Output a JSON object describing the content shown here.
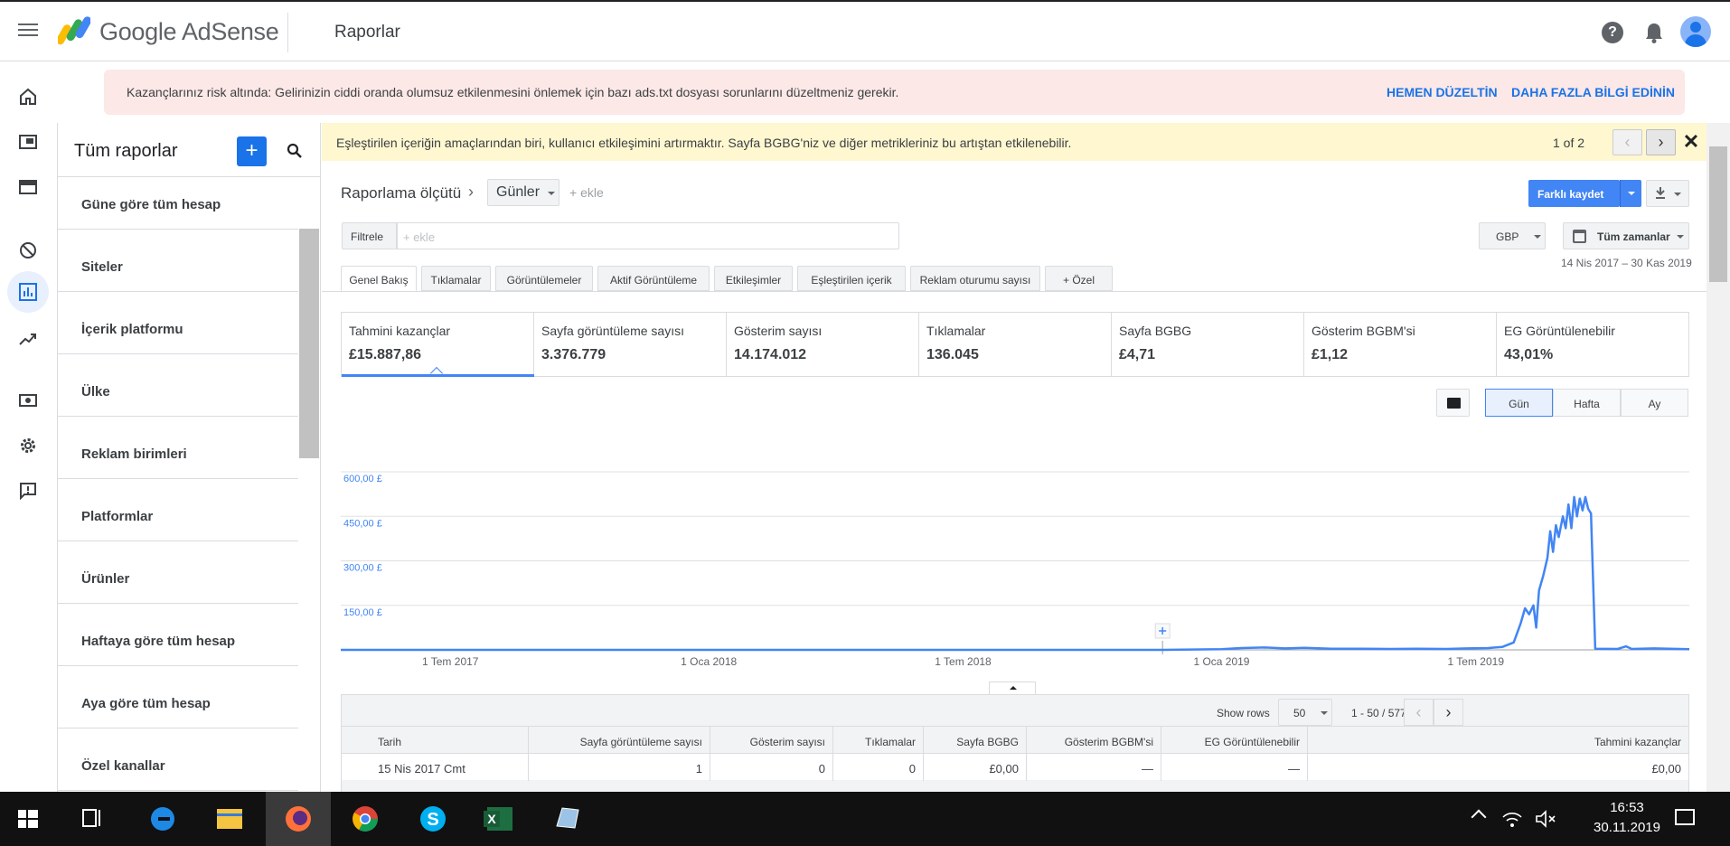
{
  "app": {
    "brand": "Google AdSense",
    "page_title": "Raporlar"
  },
  "risk_banner": {
    "text": "Kazançlarınız risk altında: Gelirinizin ciddi oranda olumsuz etkilenmesini önlemek için bazı ads.txt dosyası sorunlarını düzeltmeniz gerekir.",
    "fix_link": "HEMEN DÜZELTİN",
    "more_link": "DAHA FAZLA BİLGİ EDİNİN"
  },
  "sidebar": {
    "title": "Tüm raporlar",
    "add_label": "+",
    "items": [
      {
        "label": "Güne göre tüm hesap"
      },
      {
        "label": "Siteler"
      },
      {
        "label": "İçerik platformu"
      },
      {
        "label": "Ülke"
      },
      {
        "label": "Reklam birimleri"
      },
      {
        "label": "Platformlar"
      },
      {
        "label": "Ürünler"
      },
      {
        "label": "Haftaya göre tüm hesap"
      },
      {
        "label": "Aya göre tüm hesap"
      },
      {
        "label": "Özel kanallar"
      }
    ]
  },
  "notice": {
    "text": "Eşleştirilen içeriğin amaçlarından biri, kullanıcı etkileşimini artırmaktır. Sayfa BGBG'niz ve diğer metrikleriniz bu artıştan etkilenebilir.",
    "count": "1 of 2",
    "prev": "‹",
    "next": "›",
    "close": "✕"
  },
  "report": {
    "metric_label": "Raporlama ölçütü",
    "chevron": "›",
    "dimension": "Günler",
    "add_dimension": "+ ekle",
    "save_as": "Farklı kaydet",
    "filter_label": "Filtrele",
    "filter_placeholder": "+ ekle",
    "currency": "GBP",
    "date_select": "Tüm zamanlar",
    "date_range": "14 Nis 2017 – 30 Kas 2019"
  },
  "tabs": [
    {
      "label": "Genel Bakış"
    },
    {
      "label": "Tıklamalar"
    },
    {
      "label": "Görüntülemeler"
    },
    {
      "label": "Aktif Görüntüleme"
    },
    {
      "label": "Etkileşimler"
    },
    {
      "label": "Eşleştirilen içerik"
    },
    {
      "label": "Reklam oturumu sayısı"
    },
    {
      "label": "+  Özel"
    }
  ],
  "metrics": [
    {
      "label": "Tahmini kazançlar",
      "value": "£15.887,86"
    },
    {
      "label": "Sayfa görüntüleme sayısı",
      "value": "3.376.779"
    },
    {
      "label": "Gösterim sayısı",
      "value": "14.174.012"
    },
    {
      "label": "Tıklamalar",
      "value": "136.045"
    },
    {
      "label": "Sayfa BGBG",
      "value": "£4,71"
    },
    {
      "label": "Gösterim BGBM'si",
      "value": "£1,12"
    },
    {
      "label": "EG Görüntülenebilir",
      "value": "43,01%"
    }
  ],
  "granularity": [
    {
      "label": "Gün"
    },
    {
      "label": "Hafta"
    },
    {
      "label": "Ay"
    }
  ],
  "chart_data": {
    "type": "line",
    "title": "",
    "series": [
      {
        "name": "Tahmini kazançlar",
        "color": "#4285f4"
      }
    ],
    "x_ticks": [
      "1 Tem 2017",
      "1 Oca 2018",
      "1 Tem 2018",
      "1 Oca 2019",
      "1 Tem 2019"
    ],
    "y_ticks": [
      "600,00 £",
      "450,00 £",
      "300,00 £",
      "150,00 £"
    ],
    "ylim": [
      0,
      600
    ],
    "x_range": [
      "2017-04-14",
      "2019-11-30"
    ],
    "points": [
      [
        "2017-04-14",
        0
      ],
      [
        "2018-11-20",
        0
      ],
      [
        "2019-01-01",
        2
      ],
      [
        "2019-01-15",
        6
      ],
      [
        "2019-02-01",
        8
      ],
      [
        "2019-02-15",
        5
      ],
      [
        "2019-03-01",
        7
      ],
      [
        "2019-03-20",
        4
      ],
      [
        "2019-04-10",
        4
      ],
      [
        "2019-05-01",
        3
      ],
      [
        "2019-05-20",
        4
      ],
      [
        "2019-06-10",
        3
      ],
      [
        "2019-06-25",
        5
      ],
      [
        "2019-07-10",
        6
      ],
      [
        "2019-07-20",
        10
      ],
      [
        "2019-07-28",
        25
      ],
      [
        "2019-08-02",
        90
      ],
      [
        "2019-08-05",
        140
      ],
      [
        "2019-08-08",
        120
      ],
      [
        "2019-08-11",
        150
      ],
      [
        "2019-08-13",
        75
      ],
      [
        "2019-08-15",
        200
      ],
      [
        "2019-08-18",
        250
      ],
      [
        "2019-08-21",
        310
      ],
      [
        "2019-08-23",
        400
      ],
      [
        "2019-08-25",
        330
      ],
      [
        "2019-08-27",
        420
      ],
      [
        "2019-08-29",
        380
      ],
      [
        "2019-09-01",
        450
      ],
      [
        "2019-09-03",
        410
      ],
      [
        "2019-09-05",
        490
      ],
      [
        "2019-09-07",
        410
      ],
      [
        "2019-09-09",
        515
      ],
      [
        "2019-09-11",
        450
      ],
      [
        "2019-09-13",
        510
      ],
      [
        "2019-09-15",
        470
      ],
      [
        "2019-09-17",
        515
      ],
      [
        "2019-09-19",
        475
      ],
      [
        "2019-09-21",
        460
      ],
      [
        "2019-09-24",
        4
      ],
      [
        "2019-10-10",
        3
      ],
      [
        "2019-10-16",
        12
      ],
      [
        "2019-10-20",
        3
      ],
      [
        "2019-11-05",
        5
      ],
      [
        "2019-11-30",
        2
      ]
    ],
    "annotation_date": "2018-11-20",
    "grid": true
  },
  "table": {
    "show_rows_label": "Show rows",
    "rows_value": "50",
    "range_label": "1 - 50 / 577",
    "columns": [
      "Tarih",
      "Sayfa görüntüleme sayısı",
      "Gösterim sayısı",
      "Tıklamalar",
      "Sayfa BGBG",
      "Gösterim BGBM'si",
      "EG Görüntülenebilir",
      "Tahmini kazançlar"
    ],
    "rows": [
      [
        "15 Nis 2017 Cmt",
        "1",
        "0",
        "0",
        "£0,00",
        "—",
        "—",
        "£0,00"
      ]
    ]
  },
  "taskbar": {
    "time": "16:53",
    "date": "30.11.2019"
  }
}
